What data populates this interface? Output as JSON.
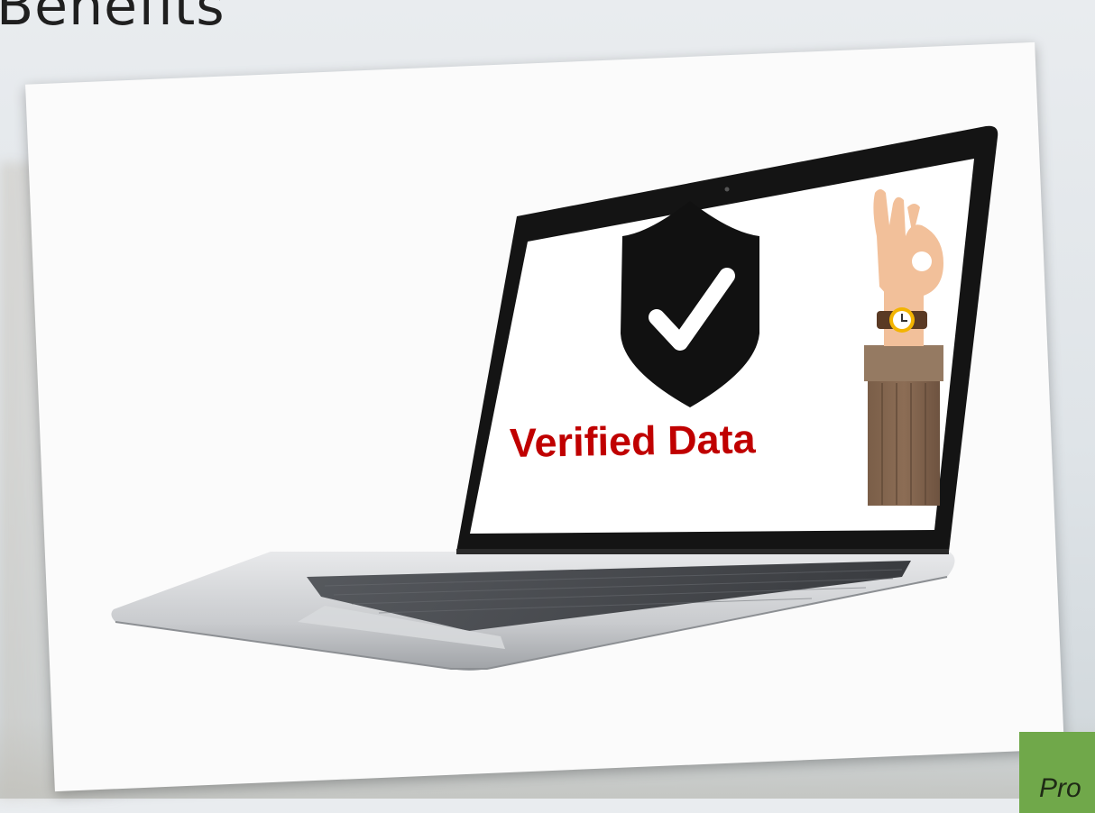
{
  "slide": {
    "title": "Benefits"
  },
  "screen": {
    "label": "Verified Data",
    "label_color": "#c00000"
  },
  "icons": {
    "shield": "shield-check-icon",
    "hand": "ok-hand-icon",
    "watch": "wristwatch-icon",
    "laptop": "laptop-icon"
  },
  "corner_tab": {
    "text": "Pro",
    "color": "#70a84a"
  }
}
